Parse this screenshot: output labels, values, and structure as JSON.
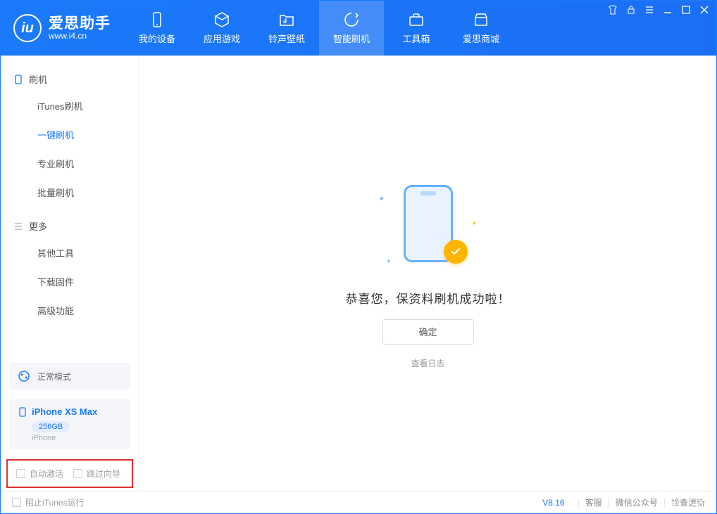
{
  "brand": {
    "name": "爱思助手",
    "url": "www.i4.cn"
  },
  "tabs": [
    {
      "label": "我的设备"
    },
    {
      "label": "应用游戏"
    },
    {
      "label": "铃声壁纸"
    },
    {
      "label": "智能刷机"
    },
    {
      "label": "工具箱"
    },
    {
      "label": "爱思商城"
    }
  ],
  "sidebar": {
    "section1": {
      "title": "刷机",
      "items": [
        "iTunes刷机",
        "一键刷机",
        "专业刷机",
        "批量刷机"
      ]
    },
    "section2": {
      "title": "更多",
      "items": [
        "其他工具",
        "下载固件",
        "高级功能"
      ]
    }
  },
  "mode": {
    "label": "正常模式"
  },
  "device": {
    "name": "iPhone XS Max",
    "capacity": "256GB",
    "type": "iPhone"
  },
  "checkboxes": {
    "auto_activate": "自动激活",
    "skip_wizard": "跳过向导"
  },
  "main": {
    "success": "恭喜您，保资料刷机成功啦！",
    "ok": "确定",
    "view_log": "查看日志"
  },
  "statusbar": {
    "block_itunes": "阻止iTunes运行",
    "version": "V8.16",
    "links": [
      "客服",
      "微信公众号",
      "检查更新"
    ]
  }
}
